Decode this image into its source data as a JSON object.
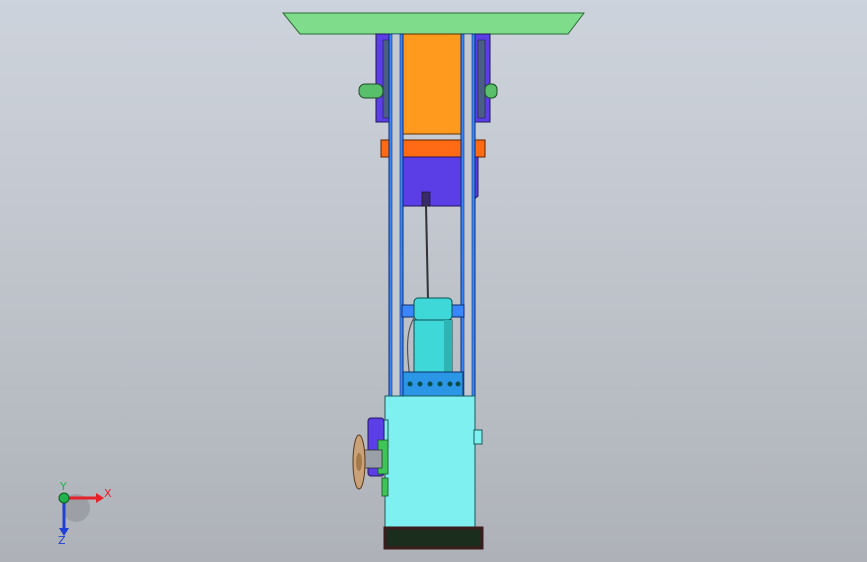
{
  "viewport": {
    "background_top": "#cdd3dc",
    "background_bottom": "#aeb2b8"
  },
  "model": {
    "colors": {
      "top_plate": "#7fdc8a",
      "cylinder": "#ff9a1e",
      "piston_band": "#ff6a14",
      "bracket": "#5b3ee6",
      "frame_rods": "#3a86ff",
      "valve_body": "#7ff0f0",
      "bonnet": "#3fd8d8",
      "handwheel": "#c9a27a",
      "pin": "#58c06a",
      "gasket": "#3a1c1c"
    }
  },
  "triad": {
    "x_label": "X",
    "y_label": "Y",
    "z_label": "Z",
    "x_color": "#e8202a",
    "y_color": "#22b14c",
    "z_color": "#1f3fd6"
  }
}
